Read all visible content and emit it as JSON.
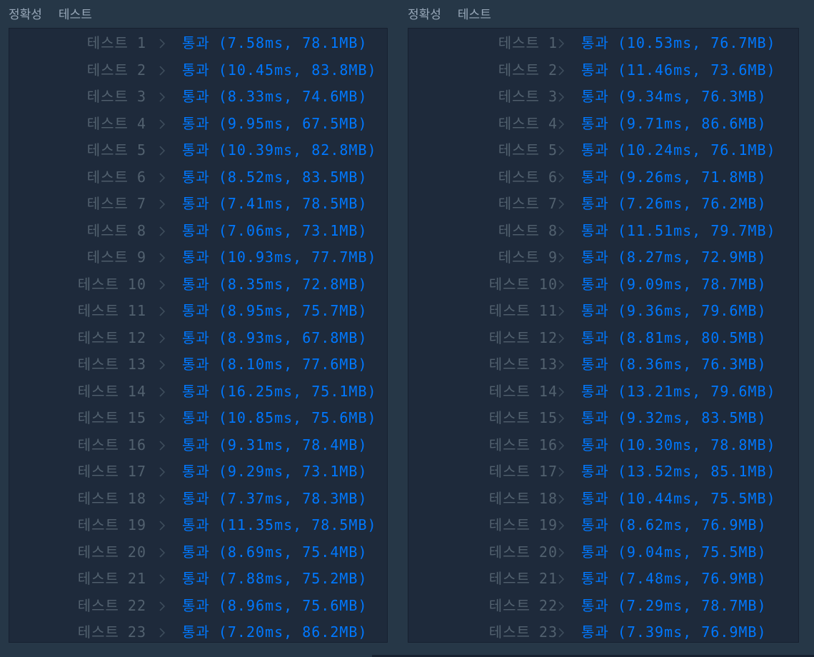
{
  "colors": {
    "background": "#263747",
    "box": "#1e2a3b",
    "label": "#52616f",
    "pass": "#0078ff",
    "header": "#98a8b9"
  },
  "panels": [
    {
      "header": {
        "tab1": "정확성",
        "tab2": "테스트"
      },
      "label_word": "테스트",
      "pass_word": "통과",
      "rows": [
        {
          "num": "1",
          "time": "7.58ms",
          "mem": "78.1MB"
        },
        {
          "num": "2",
          "time": "10.45ms",
          "mem": "83.8MB"
        },
        {
          "num": "3",
          "time": "8.33ms",
          "mem": "74.6MB"
        },
        {
          "num": "4",
          "time": "9.95ms",
          "mem": "67.5MB"
        },
        {
          "num": "5",
          "time": "10.39ms",
          "mem": "82.8MB"
        },
        {
          "num": "6",
          "time": "8.52ms",
          "mem": "83.5MB"
        },
        {
          "num": "7",
          "time": "7.41ms",
          "mem": "78.5MB"
        },
        {
          "num": "8",
          "time": "7.06ms",
          "mem": "73.1MB"
        },
        {
          "num": "9",
          "time": "10.93ms",
          "mem": "77.7MB"
        },
        {
          "num": "10",
          "time": "8.35ms",
          "mem": "72.8MB"
        },
        {
          "num": "11",
          "time": "8.95ms",
          "mem": "75.7MB"
        },
        {
          "num": "12",
          "time": "8.93ms",
          "mem": "67.8MB"
        },
        {
          "num": "13",
          "time": "8.10ms",
          "mem": "77.6MB"
        },
        {
          "num": "14",
          "time": "16.25ms",
          "mem": "75.1MB"
        },
        {
          "num": "15",
          "time": "10.85ms",
          "mem": "75.6MB"
        },
        {
          "num": "16",
          "time": "9.31ms",
          "mem": "78.4MB"
        },
        {
          "num": "17",
          "time": "9.29ms",
          "mem": "73.1MB"
        },
        {
          "num": "18",
          "time": "7.37ms",
          "mem": "78.3MB"
        },
        {
          "num": "19",
          "time": "11.35ms",
          "mem": "78.5MB"
        },
        {
          "num": "20",
          "time": "8.69ms",
          "mem": "75.4MB"
        },
        {
          "num": "21",
          "time": "7.88ms",
          "mem": "75.2MB"
        },
        {
          "num": "22",
          "time": "8.96ms",
          "mem": "75.6MB"
        },
        {
          "num": "23",
          "time": "7.20ms",
          "mem": "86.2MB"
        }
      ]
    },
    {
      "header": {
        "tab1": "정확성",
        "tab2": "테스트"
      },
      "label_word": "테스트",
      "pass_word": "통과",
      "rows": [
        {
          "num": "1",
          "time": "10.53ms",
          "mem": "76.7MB"
        },
        {
          "num": "2",
          "time": "11.46ms",
          "mem": "73.6MB"
        },
        {
          "num": "3",
          "time": "9.34ms",
          "mem": "76.3MB"
        },
        {
          "num": "4",
          "time": "9.71ms",
          "mem": "86.6MB"
        },
        {
          "num": "5",
          "time": "10.24ms",
          "mem": "76.1MB"
        },
        {
          "num": "6",
          "time": "9.26ms",
          "mem": "71.8MB"
        },
        {
          "num": "7",
          "time": "7.26ms",
          "mem": "76.2MB"
        },
        {
          "num": "8",
          "time": "11.51ms",
          "mem": "79.7MB"
        },
        {
          "num": "9",
          "time": "8.27ms",
          "mem": "72.9MB"
        },
        {
          "num": "10",
          "time": "9.09ms",
          "mem": "78.7MB"
        },
        {
          "num": "11",
          "time": "9.36ms",
          "mem": "79.6MB"
        },
        {
          "num": "12",
          "time": "8.81ms",
          "mem": "80.5MB"
        },
        {
          "num": "13",
          "time": "8.36ms",
          "mem": "76.3MB"
        },
        {
          "num": "14",
          "time": "13.21ms",
          "mem": "79.6MB"
        },
        {
          "num": "15",
          "time": "9.32ms",
          "mem": "83.5MB"
        },
        {
          "num": "16",
          "time": "10.30ms",
          "mem": "78.8MB"
        },
        {
          "num": "17",
          "time": "13.52ms",
          "mem": "85.1MB"
        },
        {
          "num": "18",
          "time": "10.44ms",
          "mem": "75.5MB"
        },
        {
          "num": "19",
          "time": "8.62ms",
          "mem": "76.9MB"
        },
        {
          "num": "20",
          "time": "9.04ms",
          "mem": "75.5MB"
        },
        {
          "num": "21",
          "time": "7.48ms",
          "mem": "76.9MB"
        },
        {
          "num": "22",
          "time": "7.29ms",
          "mem": "78.7MB"
        },
        {
          "num": "23",
          "time": "7.39ms",
          "mem": "76.9MB"
        }
      ]
    }
  ],
  "icons": {
    "row_chevron": "chevron-right-icon"
  }
}
